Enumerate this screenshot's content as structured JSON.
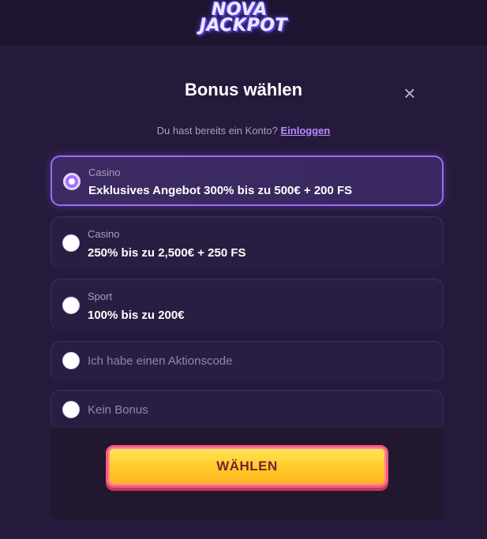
{
  "header": {
    "logo_line1": "NOVA",
    "logo_line2": "JACKPOT"
  },
  "modal": {
    "title": "Bonus wählen",
    "close_symbol": "×",
    "login_prompt": "Du hast bereits ein Konto?",
    "login_link": "Einloggen"
  },
  "options": [
    {
      "category": "Casino",
      "text": "Exklusives Angebot 300% bis zu 500€ + 200 FS",
      "selected": true
    },
    {
      "category": "Casino",
      "text": "250% bis zu 2,500€ + 250 FS",
      "selected": false
    },
    {
      "category": "Sport",
      "text": "100% bis zu 200€",
      "selected": false
    },
    {
      "category": "",
      "text": "Ich habe einen Aktionscode",
      "selected": false
    },
    {
      "category": "",
      "text": "Kein Bonus",
      "selected": false
    }
  ],
  "actions": {
    "choose_label": "WÄHLEN"
  },
  "colors": {
    "accent": "#9c6bff",
    "button": "#ffc928",
    "button_border": "#ff5a7a"
  }
}
